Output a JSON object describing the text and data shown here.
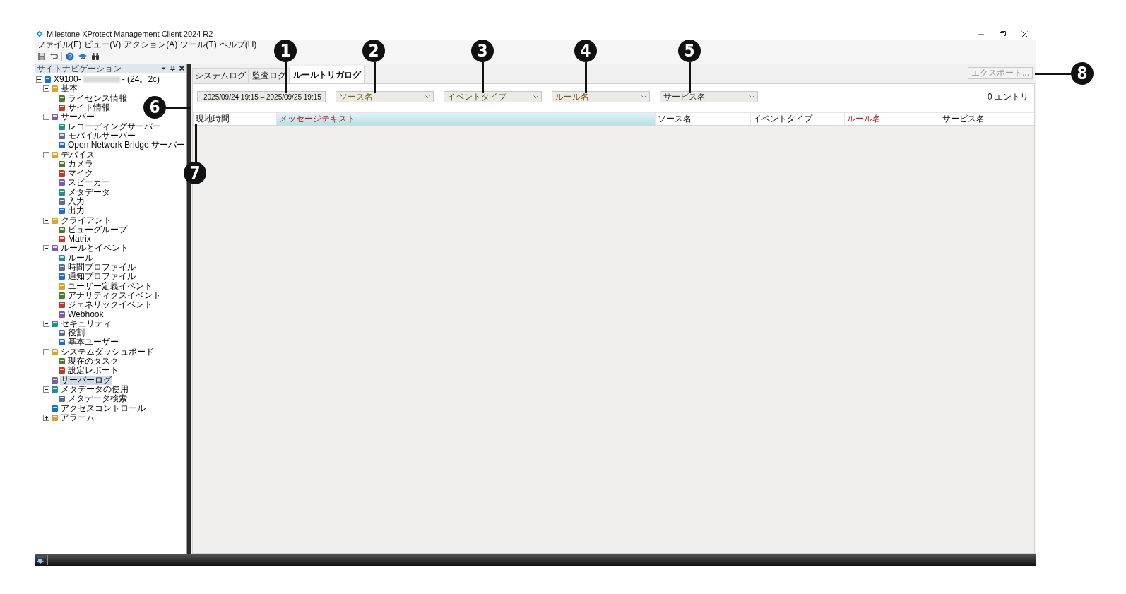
{
  "window": {
    "title": "Milestone XProtect Management Client 2024 R2"
  },
  "menu": [
    "ファイル(F)",
    "ビュー(V)",
    "アクション(A)",
    "ツール(T)",
    "ヘルプ(H)"
  ],
  "site_navigation": {
    "title": "サイトナビゲーション",
    "tree": [
      {
        "label": "X9100-",
        "suffix": "- (24。2c)",
        "selected": false,
        "expanded": true,
        "children": [
          {
            "label": "基本",
            "selected": false,
            "expanded": true,
            "children": [
              {
                "label": "ライセンス情報",
                "selected": false
              },
              {
                "label": "サイト情報",
                "selected": false
              }
            ]
          },
          {
            "label": "サーバー",
            "selected": false,
            "expanded": true,
            "children": [
              {
                "label": "レコーディングサーバー",
                "selected": false
              },
              {
                "label": "モバイルサーバー",
                "selected": false
              },
              {
                "label": "Open Network Bridge サーバー",
                "selected": false
              }
            ]
          },
          {
            "label": "デバイス",
            "selected": false,
            "expanded": true,
            "children": [
              {
                "label": "カメラ",
                "selected": false
              },
              {
                "label": "マイク",
                "selected": false
              },
              {
                "label": "スピーカー",
                "selected": false
              },
              {
                "label": "メタデータ",
                "selected": false
              },
              {
                "label": "入力",
                "selected": false
              },
              {
                "label": "出力",
                "selected": false
              }
            ]
          },
          {
            "label": "クライアント",
            "selected": false,
            "expanded": true,
            "children": [
              {
                "label": "ビューグループ",
                "selected": false
              },
              {
                "label": "Matrix",
                "selected": false
              }
            ]
          },
          {
            "label": "ルールとイベント",
            "selected": false,
            "expanded": true,
            "children": [
              {
                "label": "ルール",
                "selected": false
              },
              {
                "label": "時間プロファイル",
                "selected": false
              },
              {
                "label": "通知プロファイル",
                "selected": false
              },
              {
                "label": "ユーザー定義イベント",
                "selected": false
              },
              {
                "label": "アナリティクスイベント",
                "selected": false
              },
              {
                "label": "ジェネリックイベント",
                "selected": false
              },
              {
                "label": "Webhook",
                "selected": false
              }
            ]
          },
          {
            "label": "セキュリティ",
            "selected": false,
            "expanded": true,
            "children": [
              {
                "label": "役割",
                "selected": false
              },
              {
                "label": "基本ユーザー",
                "selected": false
              }
            ]
          },
          {
            "label": "システムダッシュボード",
            "selected": false,
            "expanded": true,
            "children": [
              {
                "label": "現在のタスク",
                "selected": false
              },
              {
                "label": "設定レポート",
                "selected": false
              }
            ]
          },
          {
            "label": "サーバーログ",
            "selected": true
          },
          {
            "label": "メタデータの使用",
            "selected": false,
            "expanded": true,
            "children": [
              {
                "label": "メタデータ検索",
                "selected": false
              }
            ]
          },
          {
            "label": "アクセスコントロール",
            "selected": false
          },
          {
            "label": "アラーム",
            "selected": false,
            "expanded": false
          }
        ]
      }
    ]
  },
  "tabs": [
    {
      "label": "システムログ",
      "selected": false
    },
    {
      "label": "監査ログ",
      "selected": false
    },
    {
      "label": "ルールトリガログ",
      "selected": true
    }
  ],
  "export_button": {
    "label": "エクスポート...",
    "disabled": true
  },
  "date_range": "2025/09/24 19:15 – 2025/09/25 19:15",
  "filters": [
    {
      "value": "ソース名"
    },
    {
      "value": "イベントタイプ"
    },
    {
      "value": "ルール名"
    },
    {
      "value": "サービス名"
    }
  ],
  "entry_count": "0 エントリ",
  "columns": [
    {
      "label": "現地時間",
      "highlighted": false,
      "emphasis": false
    },
    {
      "label": "メッセージテキスト",
      "highlighted": true,
      "emphasis": true
    },
    {
      "label": "ソース名",
      "highlighted": false,
      "emphasis": false
    },
    {
      "label": "イベントタイプ",
      "highlighted": false,
      "emphasis": false
    },
    {
      "label": "ルール名",
      "highlighted": false,
      "emphasis": true
    },
    {
      "label": "サービス名",
      "highlighted": false,
      "emphasis": false
    }
  ],
  "callouts": [
    {
      "number": "1"
    },
    {
      "number": "2"
    },
    {
      "number": "3"
    },
    {
      "number": "4"
    },
    {
      "number": "5"
    },
    {
      "number": "6"
    },
    {
      "number": "7"
    },
    {
      "number": "8"
    }
  ]
}
